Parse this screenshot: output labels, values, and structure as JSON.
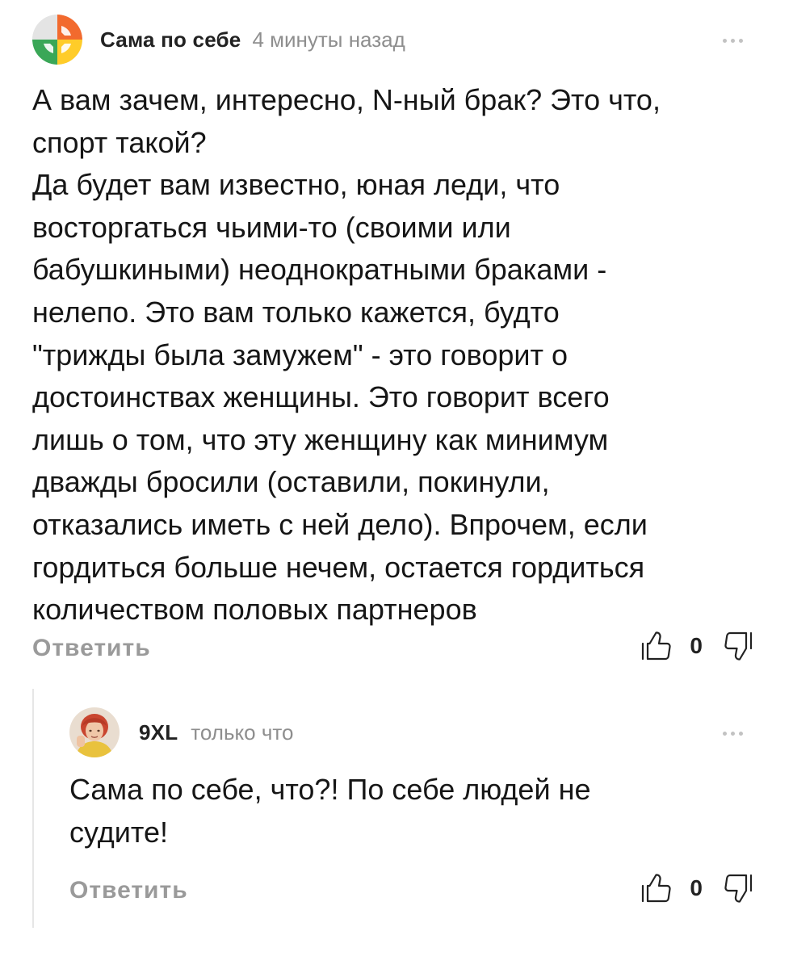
{
  "comments": [
    {
      "author": "Сама по себе",
      "time": "4 минуты назад",
      "text": "А вам зачем, интересно, N-ный брак? Это что,\nспорт такой?\nДа будет вам известно, юная леди, что\nвосторгаться чьими-то (своими или\nбабушкиными) неоднократными браками -\nнелепо. Это вам только кажется, будто\n\"трижды была замужем\" - это говорит о\nдостоинствах женщины. Это говорит всего\nлишь о том, что эту женщину как минимум\nдважды бросили (оставили, покинули,\nотказались иметь с ней дело). Впрочем, если\nгордиться больше нечем, остается гордиться\nколичеством половых партнеров",
      "reply_label": "Ответить",
      "likes": "0",
      "avatar_icon": "colorful-logo-avatar",
      "avatar_colors": [
        "#f26a2e",
        "#ffcc29",
        "#3aa757",
        "#e8e8e8"
      ]
    },
    {
      "author": "9XL",
      "time": "только что",
      "text": "Сама по себе, что?! По себе людей не\nсудите!",
      "reply_label": "Ответить",
      "likes": "0",
      "avatar_icon": "user-photo-avatar"
    }
  ],
  "icons": {
    "like": "thumbs-up-icon",
    "dislike": "thumbs-down-icon",
    "more": "more-dots-icon"
  },
  "colors": {
    "text": "#161616",
    "muted": "#8e8e8e",
    "reply": "#9a9a9a",
    "thread_line": "#e6e6e6"
  }
}
